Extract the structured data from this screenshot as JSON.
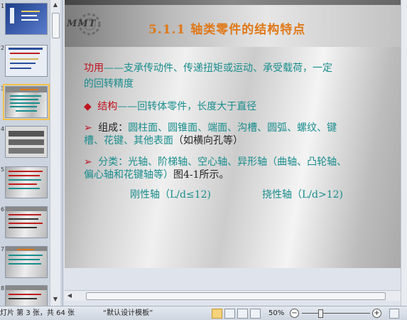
{
  "thumbnails": {
    "numbers": [
      "1",
      "2",
      "3",
      "4",
      "5",
      "6",
      "7",
      "8"
    ],
    "selected_index": 2
  },
  "slide": {
    "logo": "MMT",
    "title": "5.1.1  轴类零件的结构特点",
    "lines": {
      "l1_red": "功用",
      "l1_teal": "——支承传动件、传递扭矩或运动、承受载荷，一定",
      "l2_teal": "的回转精度",
      "l3_bullet": "◆",
      "l3_red": "结构",
      "l3_teal": "——回转体零件，长度大于直径",
      "l4_bullet": "➢",
      "l4_dark": "组成：",
      "l4_teal": "圆柱面、圆锥面、端面、沟槽、圆弧、螺纹、键",
      "l5_teal": "槽、花键、其他表面",
      "l5_dark": "（如横向孔等）",
      "l6_bullet": "➢",
      "l6_teal": "分类：光轴、阶梯轴、空心轴、异形轴（曲轴、凸轮轴、",
      "l7_teal": "偏心轴和花键轴等）",
      "l7_dark": "图4-1所示。",
      "l8a": "刚性轴（L/d≤12)",
      "l8b": "挠性轴（L/d>12)"
    }
  },
  "status": {
    "slide_info": "灯片 第 3 张，共 64 张",
    "theme": "“默认设计模板”",
    "zoom": "50%",
    "zoom_minus": "−",
    "zoom_plus": "+"
  },
  "colors": {
    "title": "#e07817",
    "accent_red": "#c0121f",
    "body_teal": "#1a8d8d"
  }
}
